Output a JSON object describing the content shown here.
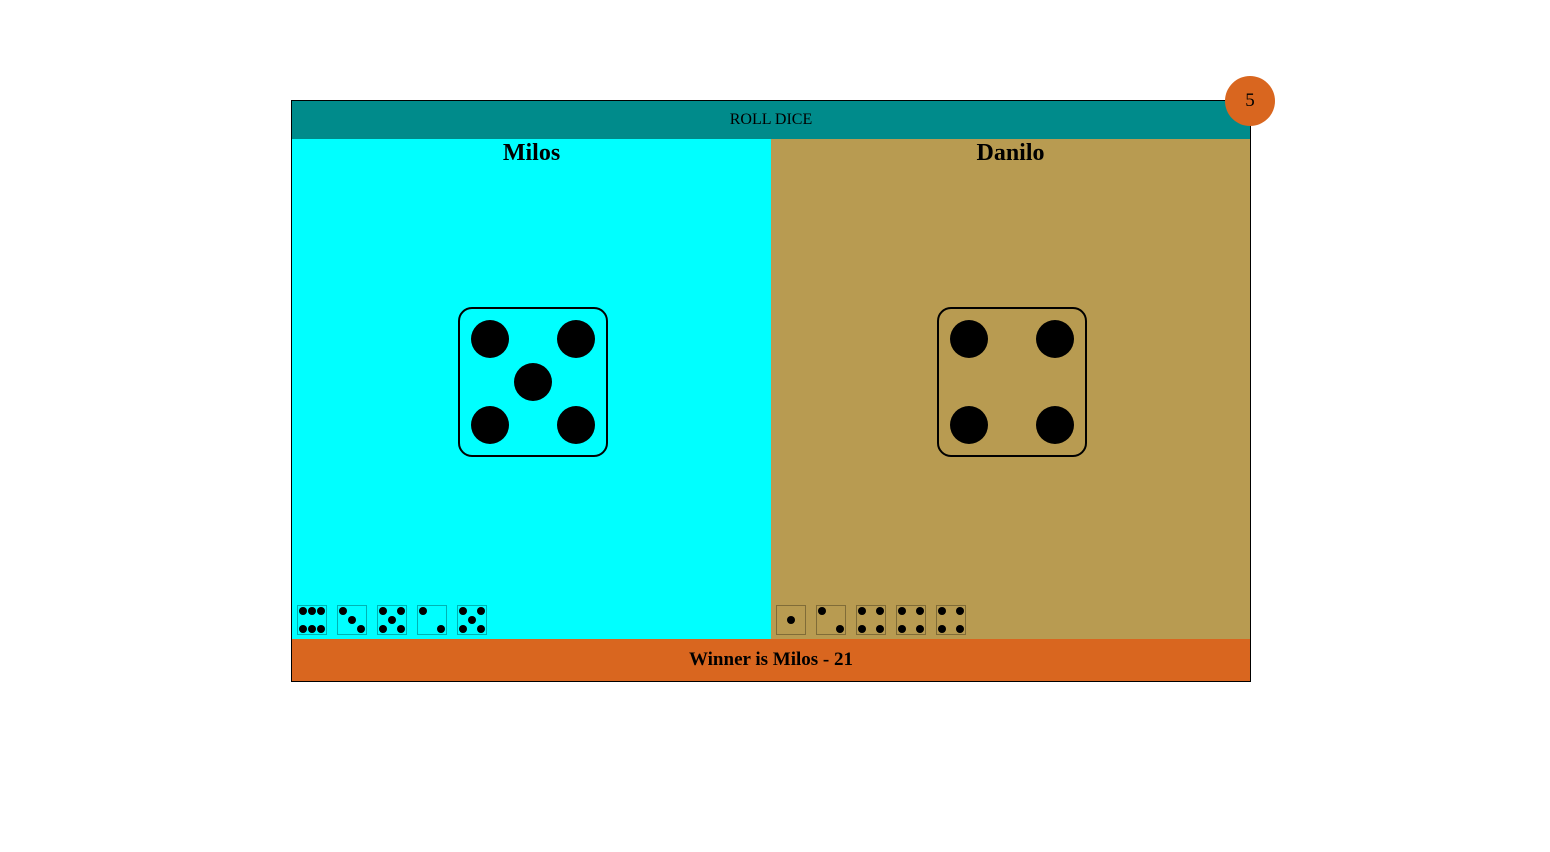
{
  "header": {
    "roll_label": "ROLL DICE",
    "roll_color": "#008b8b",
    "round_counter": "5",
    "counter_color": "#d9661f"
  },
  "players": [
    {
      "name": "Milos",
      "panel_color": "#00ffff",
      "current_die": 5,
      "history": [
        6,
        3,
        5,
        2,
        5
      ]
    },
    {
      "name": "Danilo",
      "panel_color": "#b89b51",
      "current_die": 4,
      "history": [
        1,
        2,
        4,
        4,
        4
      ]
    }
  ],
  "result": {
    "text": "Winner is Milos - 21",
    "bar_color": "#d9661f"
  }
}
